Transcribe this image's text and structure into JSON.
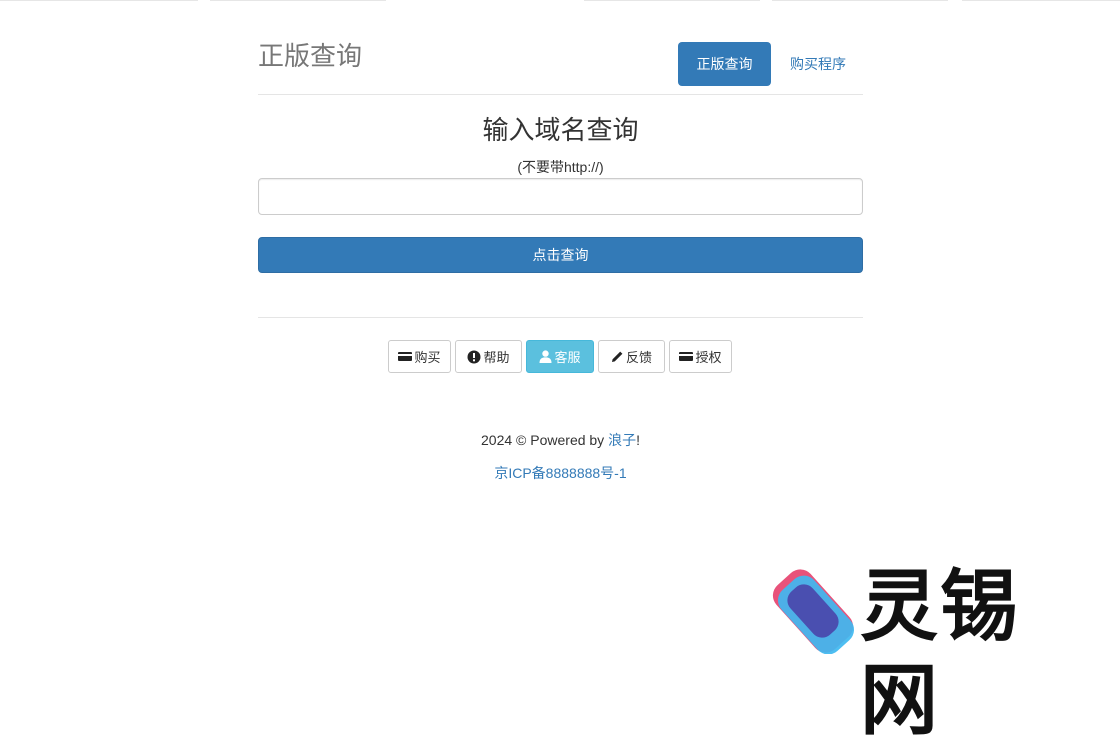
{
  "header": {
    "title": "正版查询",
    "nav": [
      {
        "label": "正版查询",
        "active": true
      },
      {
        "label": "购买程序",
        "active": false
      }
    ]
  },
  "query": {
    "title": "输入域名查询",
    "hint": "(不要带http://)",
    "input_value": "",
    "input_placeholder": "",
    "button_label": "点击查询"
  },
  "buttons": [
    {
      "label": "购买",
      "icon": "credit-card-icon"
    },
    {
      "label": "帮助",
      "icon": "exclamation-circle-icon"
    },
    {
      "label": "客服",
      "icon": "user-icon"
    },
    {
      "label": "反馈",
      "icon": "pencil-icon"
    },
    {
      "label": "授权",
      "icon": "credit-card-icon"
    }
  ],
  "footer": {
    "prefix": "2024 © Powered by ",
    "author": "浪子",
    "suffix": "!",
    "icp": "京ICP备8888888号-1"
  },
  "watermark": {
    "text": "灵锡网"
  },
  "colors": {
    "primary": "#337ab7",
    "info": "#5bc0de",
    "muted": "#777777"
  }
}
